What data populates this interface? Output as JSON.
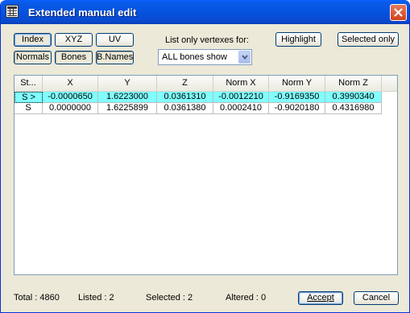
{
  "window": {
    "title": "Extended manual edit",
    "icon": "grid-table-icon",
    "close_icon": "close-x-icon"
  },
  "toolbar": {
    "index_label": "Index",
    "xyz_label": "XYZ",
    "uv_label": "UV",
    "normals_label": "Normals",
    "bones_label": "Bones",
    "bnames_label": "B.Names",
    "list_only_label": "List only vertexes for:",
    "bones_filter": {
      "selected": "ALL bones show"
    },
    "highlight_label": "Highlight",
    "selected_only_label": "Selected only"
  },
  "table": {
    "columns": [
      "St...",
      "X",
      "Y",
      "Z",
      "Norm X",
      "Norm Y",
      "Norm Z"
    ],
    "rows": [
      [
        "S >",
        "-0.0000650",
        "1.6223000",
        "0.0361310",
        "-0.0012210",
        "-0.9169350",
        "0.3990340"
      ],
      [
        "S",
        "0.0000000",
        "1.6225899",
        "0.0361380",
        "0.0002410",
        "-0.9020180",
        "0.4316980"
      ]
    ],
    "selected_row": 0
  },
  "status": {
    "total": "Total : 4860",
    "listed": "Listed : 2",
    "selected": "Selected : 2",
    "altered": "Altered : 0"
  },
  "actions": {
    "accept_label": "Accept",
    "cancel_label": "Cancel"
  },
  "colors": {
    "title_bar": "#0454e0",
    "selected_row": "#80ffff",
    "dialog_bg": "#ece9d8"
  }
}
